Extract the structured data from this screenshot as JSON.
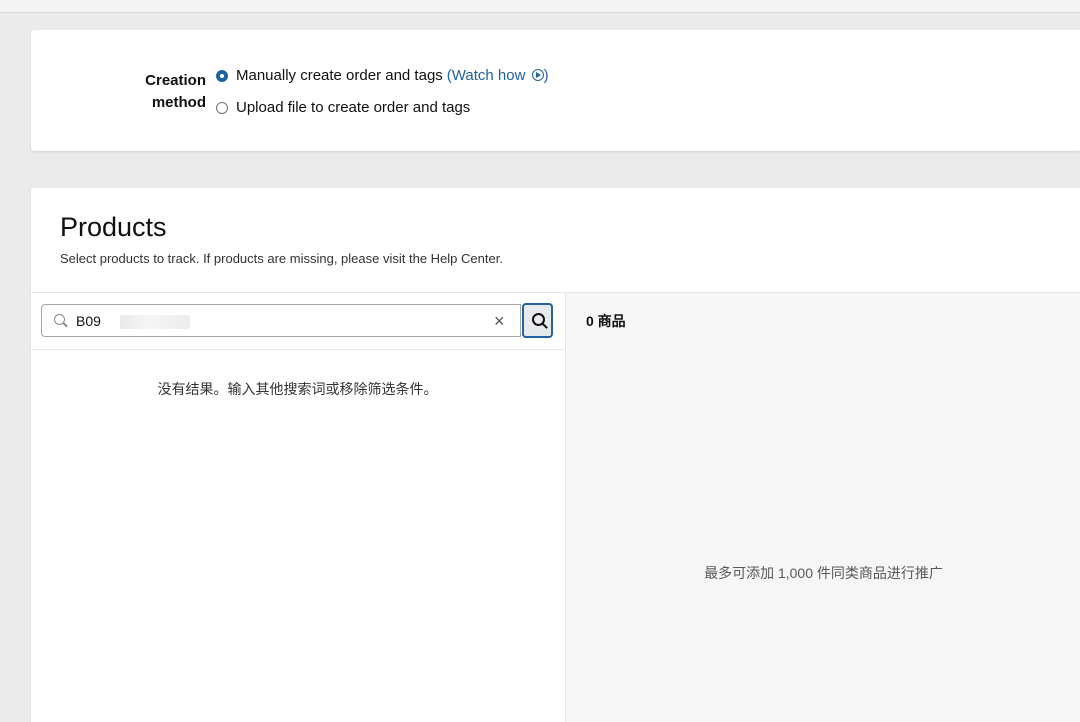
{
  "creation": {
    "label_line1": "Creation",
    "label_line2": "method",
    "options": [
      {
        "label": "Manually create order and tags",
        "selected": true
      },
      {
        "label": "Upload file to create order and tags",
        "selected": false
      }
    ],
    "watch_link": "(Watch how",
    "watch_link_close": ")"
  },
  "products": {
    "title": "Products",
    "subtitle": "Select products to track. If products are missing, please visit the Help Center."
  },
  "search": {
    "value": "B09"
  },
  "left_panel": {
    "no_results": "没有结果。输入其他搜索词或移除筛选条件。"
  },
  "right_panel": {
    "count_label": "0 商品",
    "limit_note": "最多可添加 1,000 件同类商品进行推广"
  },
  "colors": {
    "accent": "#2162a1",
    "background": "#ebebeb"
  }
}
